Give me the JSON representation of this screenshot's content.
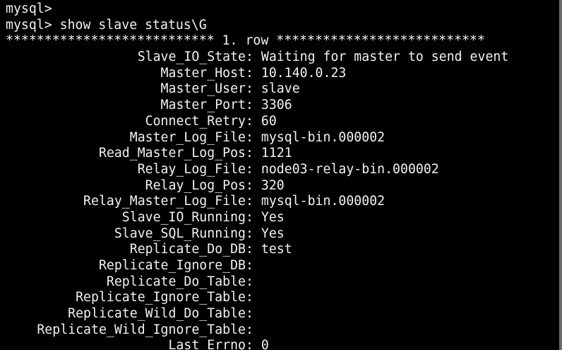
{
  "terminal": {
    "prompt1": "mysql>",
    "prompt2": "mysql> show slave status\\G",
    "row_header": "*************************** 1. row ***************************",
    "fields": [
      {
        "key": "Slave_IO_State",
        "value": "Waiting for master to send event"
      },
      {
        "key": "Master_Host",
        "value": "10.140.0.23"
      },
      {
        "key": "Master_User",
        "value": "slave"
      },
      {
        "key": "Master_Port",
        "value": "3306"
      },
      {
        "key": "Connect_Retry",
        "value": "60"
      },
      {
        "key": "Master_Log_File",
        "value": "mysql-bin.000002"
      },
      {
        "key": "Read_Master_Log_Pos",
        "value": "1121"
      },
      {
        "key": "Relay_Log_File",
        "value": "node03-relay-bin.000002"
      },
      {
        "key": "Relay_Log_Pos",
        "value": "320"
      },
      {
        "key": "Relay_Master_Log_File",
        "value": "mysql-bin.000002"
      },
      {
        "key": "Slave_IO_Running",
        "value": "Yes"
      },
      {
        "key": "Slave_SQL_Running",
        "value": "Yes"
      },
      {
        "key": "Replicate_Do_DB",
        "value": "test"
      },
      {
        "key": "Replicate_Ignore_DB",
        "value": ""
      },
      {
        "key": "Replicate_Do_Table",
        "value": ""
      },
      {
        "key": "Replicate_Ignore_Table",
        "value": ""
      },
      {
        "key": "Replicate_Wild_Do_Table",
        "value": ""
      },
      {
        "key": "Replicate_Wild_Ignore_Table",
        "value": ""
      },
      {
        "key": "Last_Errno",
        "value": "0"
      }
    ],
    "colors": {
      "background": "#000000",
      "foreground": "#f2f2f2",
      "border": "#6a6a6a"
    }
  }
}
